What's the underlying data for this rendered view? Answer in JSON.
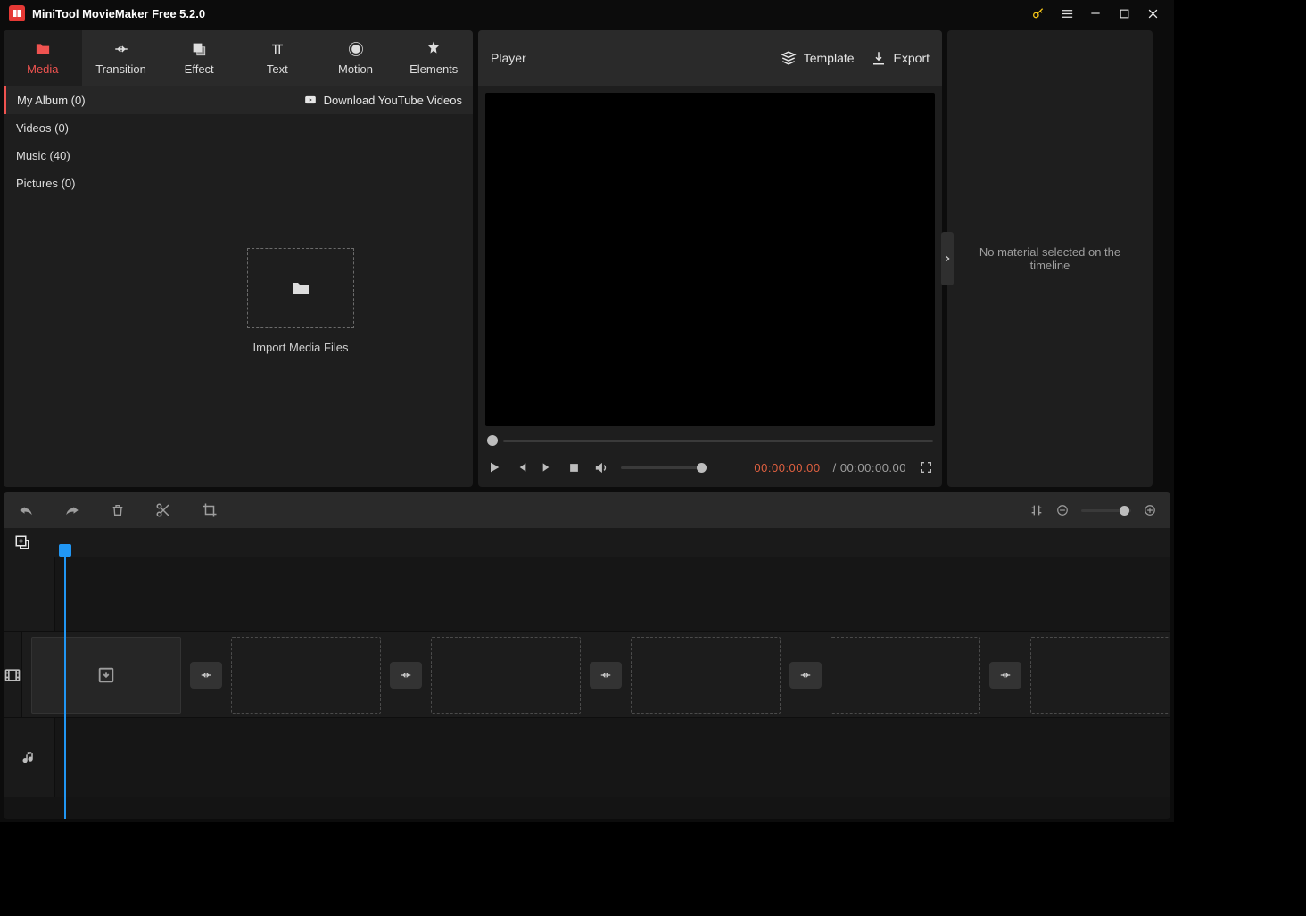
{
  "title": "MiniTool MovieMaker Free 5.2.0",
  "tabs": [
    {
      "label": "Media"
    },
    {
      "label": "Transition"
    },
    {
      "label": "Effect"
    },
    {
      "label": "Text"
    },
    {
      "label": "Motion"
    },
    {
      "label": "Elements"
    }
  ],
  "subbar": {
    "album": "My Album (0)",
    "download": "Download YouTube Videos"
  },
  "media_categories": [
    {
      "label": "Videos (0)"
    },
    {
      "label": "Music (40)"
    },
    {
      "label": "Pictures (0)"
    }
  ],
  "import_label": "Import Media Files",
  "player": {
    "title": "Player",
    "template": "Template",
    "export": "Export",
    "current_tc": "00:00:00.00",
    "total_tc": "/ 00:00:00.00"
  },
  "props_msg": "No material selected on the timeline"
}
